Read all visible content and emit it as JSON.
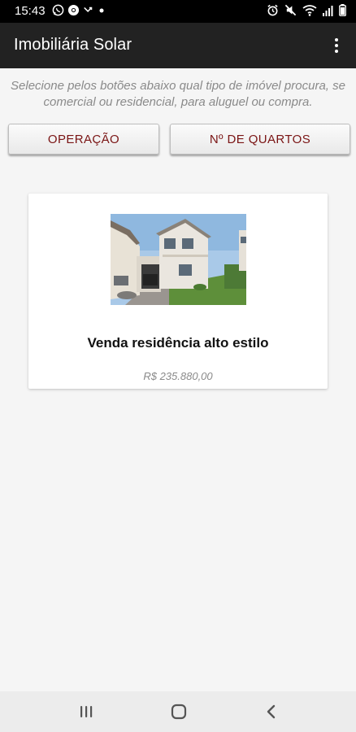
{
  "status_bar": {
    "time": "15:43",
    "left_icons": [
      "whatsapp-icon",
      "chrome-icon",
      "missed-call-icon",
      "dot-icon"
    ],
    "right_icons": [
      "alarm-icon",
      "mute-icon",
      "wifi-icon",
      "signal-icon",
      "battery-icon"
    ]
  },
  "app_bar": {
    "title": "Imobiliária Solar",
    "menu_icon": "overflow-menu-icon"
  },
  "instructions": "Selecione pelos botões abaixo qual tipo de imóvel procura, se comercial ou residencial, para aluguel ou compra.",
  "filters": {
    "operation_label": "OPERAÇÃO",
    "rooms_label": "Nº DE QUARTOS"
  },
  "listings": [
    {
      "title": "Venda residência alto estilo",
      "price": "R$ 235.880,00"
    }
  ],
  "nav_bar": {
    "recents_icon": "recent-apps-icon",
    "home_icon": "home-icon",
    "back_icon": "back-icon"
  },
  "colors": {
    "app_bar": "#222222",
    "status_bar": "#000000",
    "button_text": "#7a1414",
    "background": "#f5f5f5",
    "muted_text": "#8a8a8a"
  }
}
